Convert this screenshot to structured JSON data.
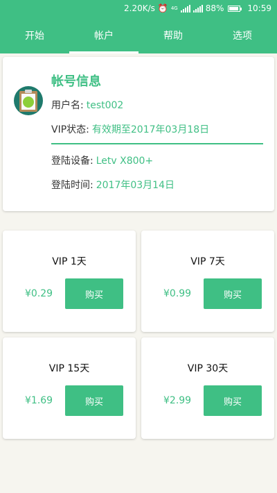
{
  "status_bar": {
    "speed": "2.20K/s",
    "network": "4G",
    "battery": "88%",
    "battery_level": 0.88,
    "time": "10:59"
  },
  "tabs": [
    {
      "label": "开始",
      "active": false
    },
    {
      "label": "帐户",
      "active": true
    },
    {
      "label": "帮助",
      "active": false
    },
    {
      "label": "选项",
      "active": false
    }
  ],
  "account": {
    "title": "帐号信息",
    "username_label": "用户名:",
    "username": "test002",
    "vip_label": "VIP状态:",
    "vip_status": "有效期至2017年03月18日",
    "device_label": "登陆设备:",
    "device": "Letv X800+",
    "login_time_label": "登陆时间:",
    "login_time": "2017年03月14日"
  },
  "vip_plans": [
    {
      "name": "VIP 1天",
      "price": "¥0.29",
      "buy_label": "购买"
    },
    {
      "name": "VIP 7天",
      "price": "¥0.99",
      "buy_label": "购买"
    },
    {
      "name": "VIP 15天",
      "price": "¥1.69",
      "buy_label": "购买"
    },
    {
      "name": "VIP 30天",
      "price": "¥2.99",
      "buy_label": "购买"
    }
  ],
  "colors": {
    "accent": "#3fbf84",
    "background": "#f6f5ef"
  }
}
